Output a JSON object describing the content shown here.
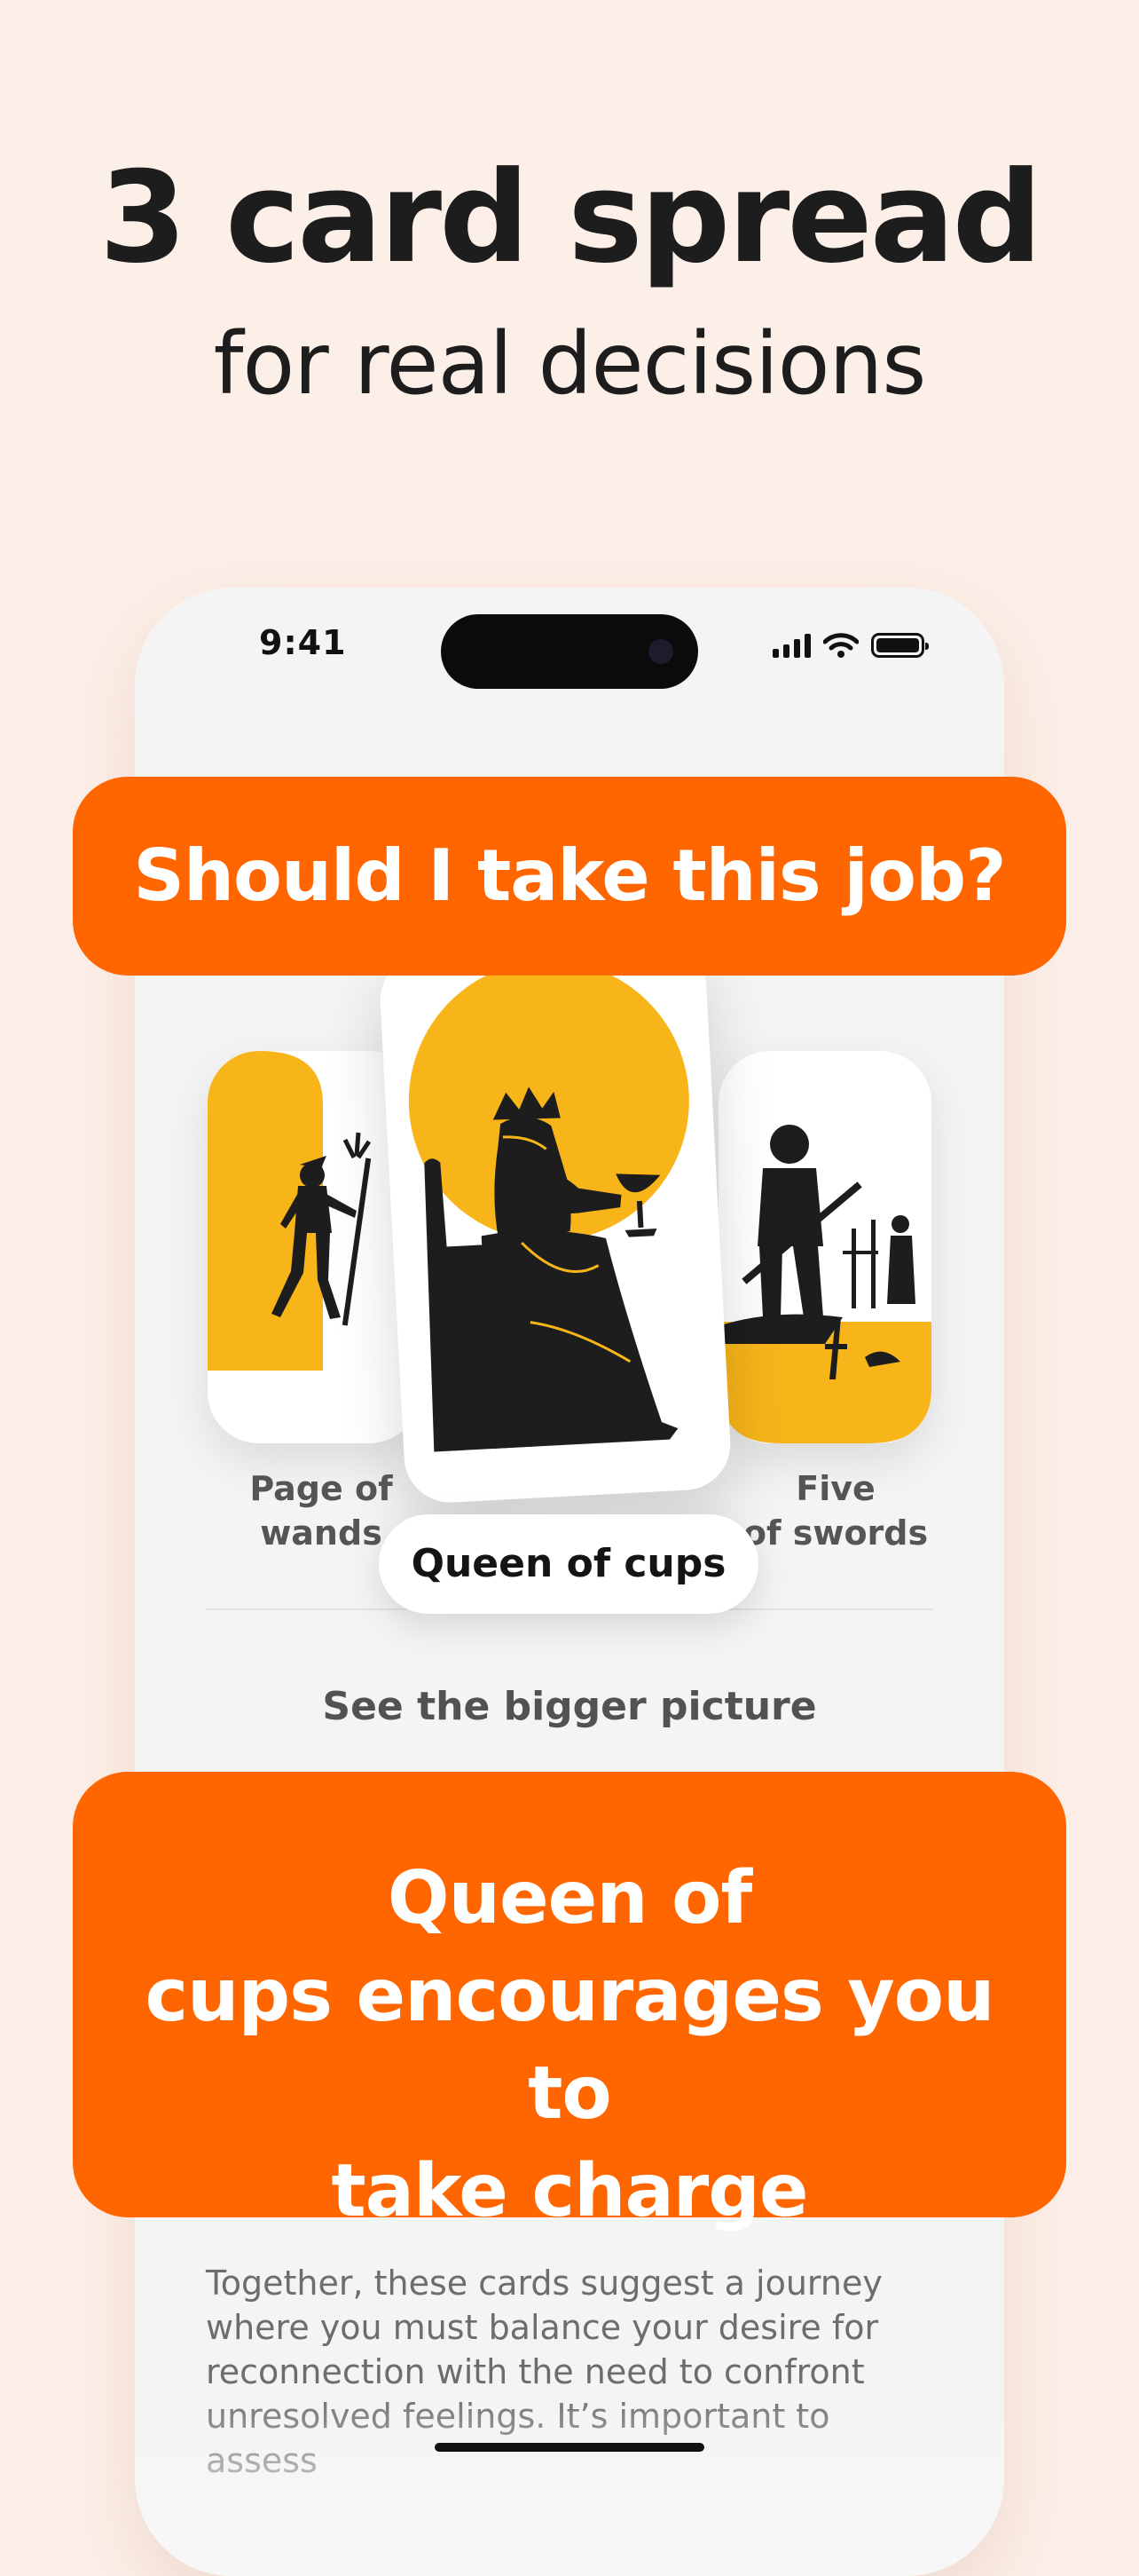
{
  "headline": {
    "title": "3 card spread",
    "subtitle": "for real decisions"
  },
  "status_bar": {
    "time": "9:41",
    "icons": [
      "signal-icon",
      "wifi-icon",
      "battery-icon"
    ]
  },
  "question": "Should I take this job?",
  "cards": {
    "left": {
      "name_line1": "Page of",
      "name_line2": "wands"
    },
    "center": {
      "name": "Queen of cups"
    },
    "right": {
      "name_line1": "Five",
      "name_line2": "of swords"
    }
  },
  "section_title": "See the bigger picture",
  "answer": {
    "line1": "Queen of",
    "line2": "cups encourages you to",
    "line3": "take charge"
  },
  "reading_text": "Together, these cards suggest a journey where you must balance your desire for reconnection with the need to confront unresolved feelings. It’s important to assess",
  "colors": {
    "background": "#fcefe8",
    "accent": "#ff6600",
    "card_yellow": "#f8b51a",
    "ink": "#1d1d1d"
  }
}
